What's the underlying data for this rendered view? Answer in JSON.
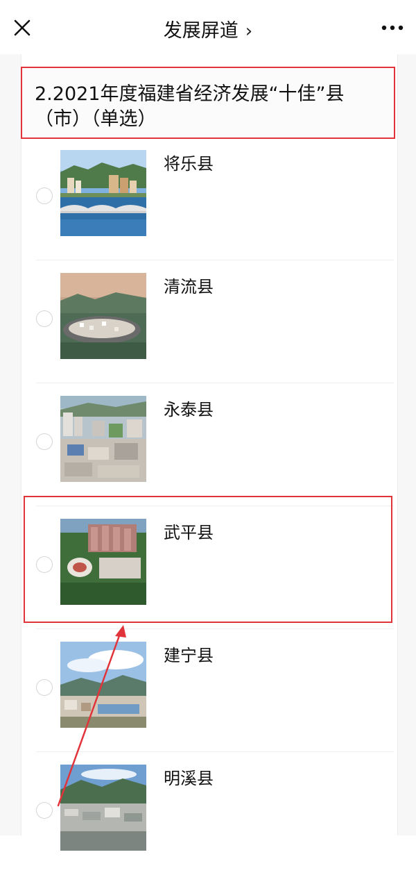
{
  "nav": {
    "title": "发展屏道",
    "close_icon": "close-icon",
    "more_icon": "more-dots-icon",
    "chevron_icon": "chevron-right-icon"
  },
  "question": {
    "text": "2.2021年度福建省经济发展“十佳”县（市）（单选）",
    "type": "single-choice"
  },
  "options": [
    {
      "label": "将乐县",
      "image": "county-photo-river-bridge",
      "selected": false
    },
    {
      "label": "清流县",
      "image": "county-photo-river-bend-town",
      "selected": false
    },
    {
      "label": "永泰县",
      "image": "county-photo-city-aerial",
      "selected": false
    },
    {
      "label": "武平县",
      "image": "county-photo-city-plaza-aerial",
      "selected": false
    },
    {
      "label": "建宁县",
      "image": "county-photo-town-mountains",
      "selected": false
    },
    {
      "label": "明溪县",
      "image": "county-photo-valley-town",
      "selected": false
    }
  ],
  "annotation": {
    "highlight_color": "#e0343a",
    "highlighted_option": "武平县",
    "arrow_color": "#e0343a"
  }
}
